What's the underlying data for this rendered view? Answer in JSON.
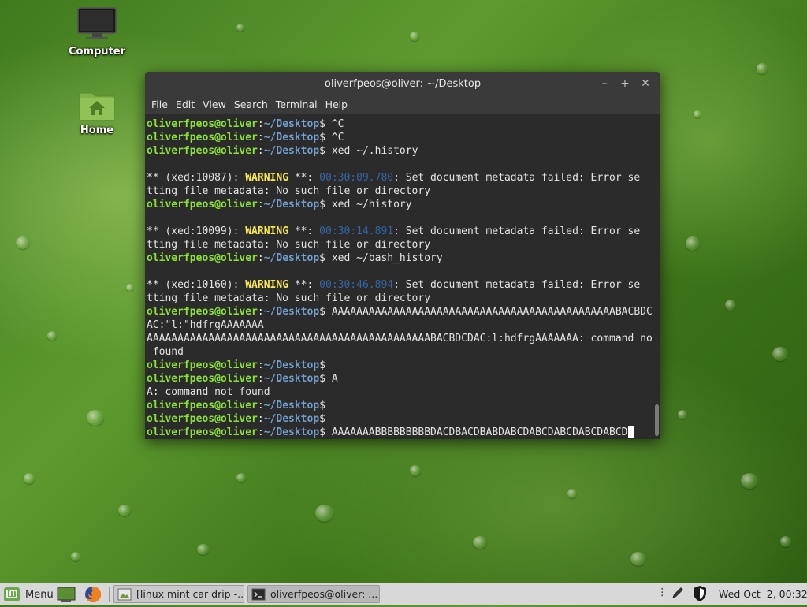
{
  "desktop": {
    "icons": [
      {
        "label": "Computer",
        "icon": "monitor-icon"
      },
      {
        "label": "Home",
        "icon": "home-folder-icon"
      }
    ]
  },
  "terminal": {
    "title": "oliverfpeos@oliver: ~/Desktop",
    "menu": [
      "File",
      "Edit",
      "View",
      "Search",
      "Terminal",
      "Help"
    ],
    "user": "oliverfpeos@oliver",
    "path": "~/Desktop",
    "lines": [
      {
        "kind": "prompt",
        "cmd": "^C"
      },
      {
        "kind": "prompt",
        "cmd": "^C"
      },
      {
        "kind": "prompt",
        "cmd": "xed ~/.history"
      },
      {
        "kind": "blank"
      },
      {
        "kind": "warn",
        "pid": "** (xed:10087): ",
        "warn": "WARNING",
        "mid": " **: ",
        "time": "00:30:09.780",
        "msg": ": Set document metadata failed: Error se"
      },
      {
        "kind": "text",
        "text": "tting file metadata: No such file or directory"
      },
      {
        "kind": "prompt",
        "cmd": "xed ~/history"
      },
      {
        "kind": "blank"
      },
      {
        "kind": "warn",
        "pid": "** (xed:10099): ",
        "warn": "WARNING",
        "mid": " **: ",
        "time": "00:30:14.891",
        "msg": ": Set document metadata failed: Error se"
      },
      {
        "kind": "text",
        "text": "tting file metadata: No such file or directory"
      },
      {
        "kind": "prompt",
        "cmd": "xed ~/bash_history"
      },
      {
        "kind": "blank"
      },
      {
        "kind": "warn",
        "pid": "** (xed:10160): ",
        "warn": "WARNING",
        "mid": " **: ",
        "time": "00:30:46.894",
        "msg": ": Set document metadata failed: Error se"
      },
      {
        "kind": "text",
        "text": "tting file metadata: No such file or directory"
      },
      {
        "kind": "prompt",
        "cmd": "AAAAAAAAAAAAAAAAAAAAAAAAAAAAAAAAAAAAAAAAAAAAAABACBDCD"
      },
      {
        "kind": "text",
        "text": "AC:\"l:\"hdfrgAAAAAAA"
      },
      {
        "kind": "text",
        "text": "AAAAAAAAAAAAAAAAAAAAAAAAAAAAAAAAAAAAAAAAAAAAAABACBDCDAC:l:hdfrgAAAAAAA: command not"
      },
      {
        "kind": "text",
        "text": " found"
      },
      {
        "kind": "prompt",
        "cmd": ""
      },
      {
        "kind": "prompt",
        "cmd": "A"
      },
      {
        "kind": "text",
        "text": "A: command not found"
      },
      {
        "kind": "prompt",
        "cmd": ""
      },
      {
        "kind": "prompt",
        "cmd": ""
      },
      {
        "kind": "prompt",
        "cmd": "AAAAAAABBBBBBBBBDACDBACDBABDABCDABCDABCDABCDABCD",
        "cursor": true
      }
    ]
  },
  "panel": {
    "menu_label": "Menu",
    "tasks": [
      {
        "label": "[linux mint car drip -...",
        "icon": "image-viewer-icon"
      },
      {
        "label": "oliverfpeos@oliver: ...",
        "icon": "terminal-icon"
      }
    ],
    "clock": "Wed Oct  2, 00:32"
  }
}
